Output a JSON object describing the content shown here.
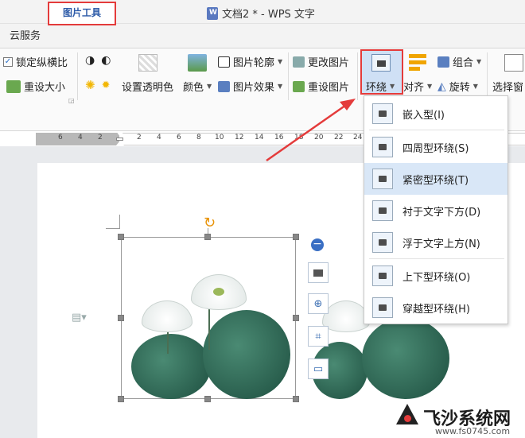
{
  "window": {
    "title": "文档2 * - WPS 文字"
  },
  "tabs": [
    {
      "label": "云服务"
    },
    {
      "label": "图片工具"
    }
  ],
  "ribbon": {
    "lock_ratio": "锁定纵横比",
    "resize": "重设大小",
    "set_transparent": "设置透明色",
    "color": "颜色",
    "outline": "图片轮廓",
    "effects": "图片效果",
    "change_pic": "更改图片",
    "reset_pic": "重设图片",
    "wrap": "环绕",
    "align": "对齐",
    "group": "组合",
    "rotate": "旋转",
    "select_pane": "选择窗"
  },
  "ruler": {
    "numbers": [
      "6",
      "4",
      "2",
      "2",
      "4",
      "6",
      "8",
      "10",
      "12",
      "14",
      "16",
      "18",
      "20",
      "22",
      "24"
    ]
  },
  "wrap_menu": {
    "items": [
      {
        "label": "嵌入型(I)"
      },
      {
        "label": "四周型环绕(S)"
      },
      {
        "label": "紧密型环绕(T)"
      },
      {
        "label": "衬于文字下方(D)"
      },
      {
        "label": "浮于文字上方(N)"
      },
      {
        "label": "上下型环绕(O)"
      },
      {
        "label": "穿越型环绕(H)"
      }
    ]
  },
  "watermark": {
    "brand": "飞沙系统网",
    "url": "www.fs0745.com"
  },
  "colors": {
    "highlight_red": "#e43b3b",
    "menu_hover": "#d9e7f7",
    "accent_blue": "#2c5aa8"
  }
}
